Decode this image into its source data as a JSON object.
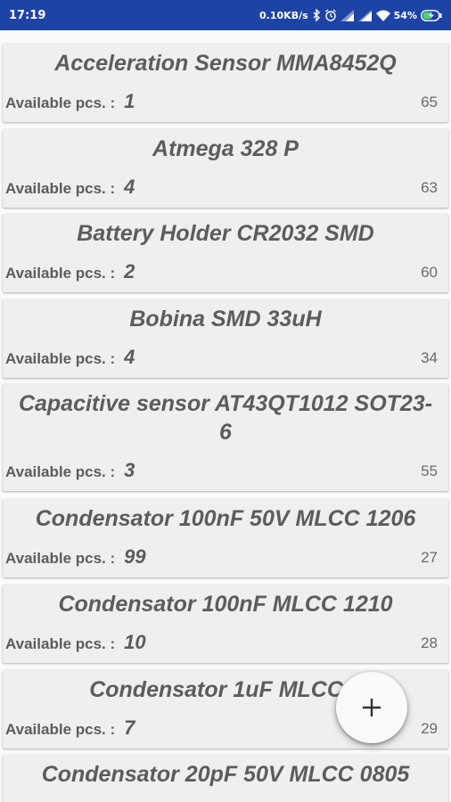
{
  "status_bar": {
    "time": "17:19",
    "net_speed": "0.10KB/s",
    "battery_percent": "54%",
    "icons": [
      "bluetooth-icon",
      "alarm-icon",
      "signal-icon",
      "signal-icon",
      "wifi-icon",
      "battery-charging-icon"
    ]
  },
  "list": {
    "available_label": "Available pcs. :",
    "items": [
      {
        "name": "Acceleration Sensor MMA8452Q",
        "qty": "1",
        "id": "65"
      },
      {
        "name": "Atmega 328 P",
        "qty": "4",
        "id": "63"
      },
      {
        "name": "Battery Holder CR2032 SMD",
        "qty": "2",
        "id": "60"
      },
      {
        "name": "Bobina SMD 33uH",
        "qty": "4",
        "id": "34"
      },
      {
        "name": "Capacitive sensor AT43QT1012 SOT23-6",
        "qty": "3",
        "id": "55"
      },
      {
        "name": "Condensator 100nF 50V MLCC 1206",
        "qty": "99",
        "id": "27"
      },
      {
        "name": "Condensator 100nF MLCC 1210",
        "qty": "10",
        "id": "28"
      },
      {
        "name": "Condensator 1uF MLCC 1",
        "qty": "7",
        "id": "29"
      },
      {
        "name": "Condensator 20pF 50V MLCC 0805",
        "qty": "",
        "id": ""
      }
    ]
  },
  "fab": {
    "icon": "plus-icon"
  },
  "colors": {
    "status_bar_bg": "#1d44a4",
    "card_bg": "#efefef",
    "text": "#5c5c5c",
    "page_bg": "#fafafa"
  }
}
